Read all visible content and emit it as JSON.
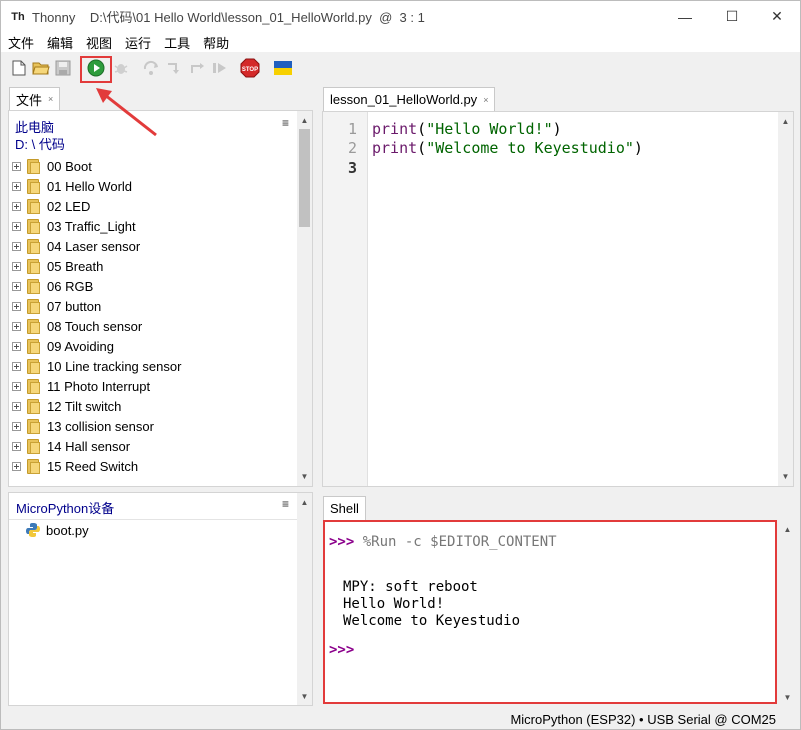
{
  "window": {
    "app_name": "Thonny",
    "title_path": "D:\\代码\\01 Hello World\\lesson_01_HelloWorld.py  @  3 : 1",
    "controls": {
      "minimize": "—",
      "maximize": "☐",
      "close": "✕"
    }
  },
  "menu": [
    "文件",
    "编辑",
    "视图",
    "运行",
    "工具",
    "帮助"
  ],
  "toolbar": {
    "buttons": [
      "new-file-icon",
      "open-file-icon",
      "save-file-icon",
      "run-icon",
      "debug-icon",
      "step-over-icon",
      "step-into-icon",
      "step-out-icon",
      "resume-icon",
      "stop-icon",
      "ukraine-flag-icon"
    ],
    "highlight_color": "#e23b3b"
  },
  "files_panel": {
    "tab_label": "文件",
    "tab_close": "×",
    "computer_label": "此电脑",
    "path_label": "D: \\ 代码",
    "menu_icon": "≡",
    "items": [
      "00 Boot",
      "01 Hello World",
      "02 LED",
      "03 Traffic_Light",
      "04 Laser sensor",
      "05 Breath",
      "06 RGB",
      "07 button",
      "08 Touch sensor",
      "09 Avoiding",
      "10 Line tracking sensor",
      "11 Photo Interrupt",
      "12 Tilt switch",
      "13 collision sensor",
      "14 Hall sensor",
      "15 Reed Switch"
    ]
  },
  "device_panel": {
    "title": "MicroPython设备",
    "menu_icon": "≡",
    "items": [
      "boot.py"
    ]
  },
  "editor": {
    "tab_label": "lesson_01_HelloWorld.py",
    "tab_close": "×",
    "line_numbers": [
      "1",
      "2",
      "3"
    ],
    "lines": [
      {
        "kw": "print",
        "open": "(",
        "str": "\"Hello World!\"",
        "close": ")"
      },
      {
        "kw": "print",
        "open": "(",
        "str": "\"Welcome to Keyestudio\"",
        "close": ")"
      }
    ]
  },
  "shell": {
    "tab_label": "Shell",
    "prompt": ">>>",
    "command": "%Run -c $EDITOR_CONTENT",
    "output": [
      "MPY: soft reboot",
      "Hello World!",
      "Welcome to Keyestudio"
    ],
    "final_prompt": ">>>",
    "highlight_color": "#e23b3b"
  },
  "status": "MicroPython (ESP32)  •  USB Serial @ COM25"
}
